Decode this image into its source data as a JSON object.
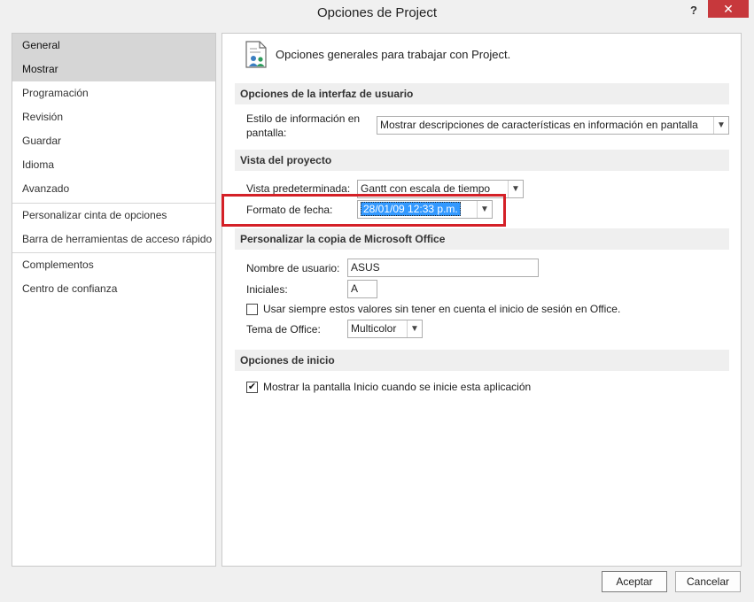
{
  "window": {
    "title": "Opciones de Project",
    "help_label": "?",
    "close_label": "✕"
  },
  "sidebar": {
    "items": [
      {
        "label": "General"
      },
      {
        "label": "Mostrar"
      },
      {
        "label": "Programación"
      },
      {
        "label": "Revisión"
      },
      {
        "label": "Guardar"
      },
      {
        "label": "Idioma"
      },
      {
        "label": "Avanzado"
      },
      {
        "label": "Personalizar cinta de opciones"
      },
      {
        "label": "Barra de herramientas de acceso rápido"
      },
      {
        "label": "Complementos"
      },
      {
        "label": "Centro de confianza"
      }
    ]
  },
  "main": {
    "header": "Opciones generales para trabajar con Project.",
    "sections": {
      "ui": "Opciones de la interfaz de usuario",
      "project_view": "Vista del proyecto",
      "office": "Personalizar la copia de Microsoft Office",
      "startup": "Opciones de inicio"
    },
    "ui": {
      "screentip_label_line1": "Estilo de información en",
      "screentip_label_line2": "pantalla:",
      "screentip_value": "Mostrar descripciones de características en información en pantalla"
    },
    "project_view": {
      "default_view_label": "Vista predeterminada:",
      "default_view_value": "Gantt con escala de tiempo",
      "date_format_label": "Formato de fecha:",
      "date_format_value": "28/01/09 12:33 p.m."
    },
    "office": {
      "username_label": "Nombre de usuario:",
      "username_value": "ASUS",
      "initials_label": "Iniciales:",
      "initials_value": "A",
      "always_use_label": "Usar siempre estos valores sin tener en cuenta el inicio de sesión en Office.",
      "always_use_checked": false,
      "theme_label": "Tema de Office:",
      "theme_value": "Multicolor"
    },
    "startup": {
      "show_start_label": "Mostrar la pantalla Inicio cuando se inicie esta aplicación",
      "show_start_checked": true
    }
  },
  "footer": {
    "ok_label": "Aceptar",
    "cancel_label": "Cancelar"
  },
  "colors": {
    "highlight_border": "#d42027",
    "selection": "#3399ff",
    "close_button": "#c7383c"
  }
}
